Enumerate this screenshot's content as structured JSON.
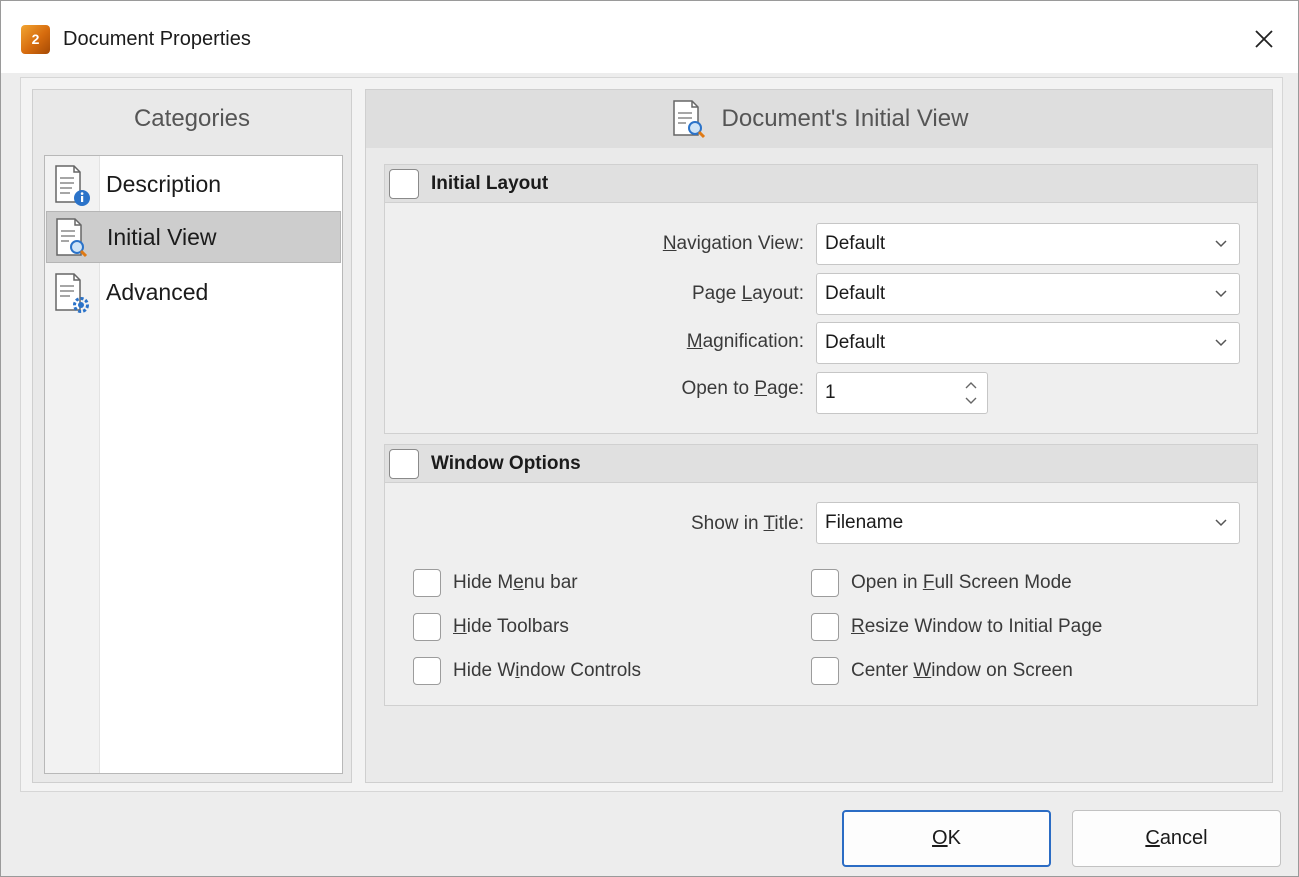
{
  "window": {
    "title": "Document Properties",
    "app_icon_label": "2"
  },
  "categories": {
    "title": "Categories",
    "items": [
      {
        "label": "Description",
        "icon": "document-info-icon"
      },
      {
        "label": "Initial View",
        "icon": "document-magnifier-icon",
        "selected": true
      },
      {
        "label": "Advanced",
        "icon": "document-gear-icon"
      }
    ]
  },
  "main": {
    "header": "Document's Initial View",
    "initial_layout": {
      "title": "Initial Layout",
      "checked": false,
      "navigation_view": {
        "label_pre": "",
        "label_key": "N",
        "label_post": "avigation View:",
        "value": "Default"
      },
      "page_layout": {
        "label_pre": "Page ",
        "label_key": "L",
        "label_post": "ayout:",
        "value": "Default"
      },
      "magnification": {
        "label_pre": "",
        "label_key": "M",
        "label_post": "agnification:",
        "value": "Default"
      },
      "open_to_page": {
        "label_pre": "Open to ",
        "label_key": "P",
        "label_post": "age:",
        "value": "1"
      }
    },
    "window_options": {
      "title": "Window Options",
      "checked": false,
      "show_in_title": {
        "label_pre": "Show in ",
        "label_key": "T",
        "label_post": "itle:",
        "value": "Filename"
      },
      "options": [
        {
          "pre": "Hide M",
          "key": "e",
          "post": "nu bar",
          "checked": false
        },
        {
          "pre": "Open in ",
          "key": "F",
          "post": "ull Screen Mode",
          "checked": false
        },
        {
          "pre": "",
          "key": "H",
          "post": "ide Toolbars",
          "checked": false
        },
        {
          "pre": "",
          "key": "R",
          "post": "esize Window to Initial Page",
          "checked": false
        },
        {
          "pre": "Hide W",
          "key": "i",
          "post": "ndow Controls",
          "checked": false
        },
        {
          "pre": "Center ",
          "key": "W",
          "post": "indow on Screen",
          "checked": false
        }
      ]
    }
  },
  "buttons": {
    "ok": {
      "key": "O",
      "post": "K"
    },
    "cancel": {
      "key": "C",
      "post": "ancel"
    }
  },
  "colors": {
    "accent": "#2b6cc4",
    "app_icon": "#e07a14"
  }
}
